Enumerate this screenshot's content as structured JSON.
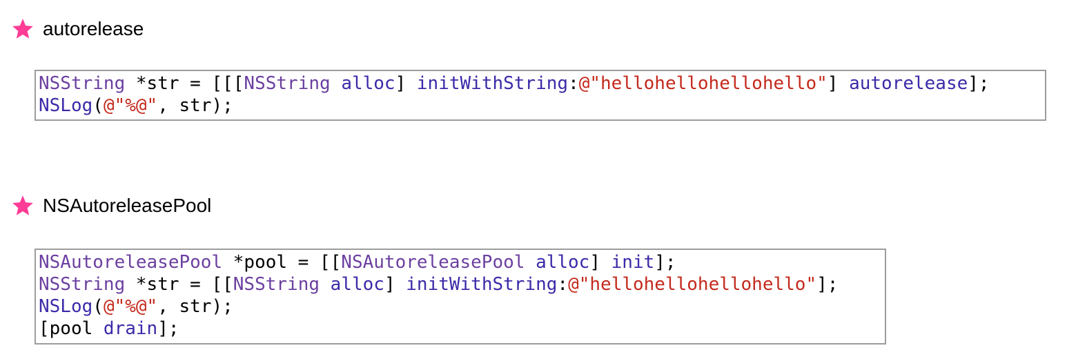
{
  "colors": {
    "star": "#ff3c96",
    "class_name": "#6b3fa0",
    "method_name": "#3a2aa8",
    "string_literal": "#c4291c",
    "plain": "#000000",
    "box_border": "#9c9c9c"
  },
  "sections": [
    {
      "icon": "star-icon",
      "heading": "autorelease",
      "code_lines": [
        [
          {
            "t": "NSString",
            "k": "class"
          },
          {
            "t": " *str = [[[",
            "k": "plain"
          },
          {
            "t": "NSString",
            "k": "class"
          },
          {
            "t": " ",
            "k": "plain"
          },
          {
            "t": "alloc",
            "k": "method"
          },
          {
            "t": "] ",
            "k": "plain"
          },
          {
            "t": "initWithString",
            "k": "method"
          },
          {
            "t": ":",
            "k": "plain"
          },
          {
            "t": "@\"hellohellohellohello\"",
            "k": "string"
          },
          {
            "t": "] ",
            "k": "plain"
          },
          {
            "t": "autorelease",
            "k": "method"
          },
          {
            "t": "];",
            "k": "plain"
          }
        ],
        [
          {
            "t": "NSLog",
            "k": "method"
          },
          {
            "t": "(",
            "k": "plain"
          },
          {
            "t": "@\"%@\"",
            "k": "string"
          },
          {
            "t": ", str);",
            "k": "plain"
          }
        ]
      ]
    },
    {
      "icon": "star-icon",
      "heading": "NSAutoreleasePool",
      "code_lines": [
        [
          {
            "t": "NSAutoreleasePool",
            "k": "class"
          },
          {
            "t": " *pool = [[",
            "k": "plain"
          },
          {
            "t": "NSAutoreleasePool",
            "k": "class"
          },
          {
            "t": " ",
            "k": "plain"
          },
          {
            "t": "alloc",
            "k": "method"
          },
          {
            "t": "] ",
            "k": "plain"
          },
          {
            "t": "init",
            "k": "method"
          },
          {
            "t": "];",
            "k": "plain"
          }
        ],
        [
          {
            "t": "NSString",
            "k": "class"
          },
          {
            "t": " *str = [[",
            "k": "plain"
          },
          {
            "t": "NSString",
            "k": "class"
          },
          {
            "t": " ",
            "k": "plain"
          },
          {
            "t": "alloc",
            "k": "method"
          },
          {
            "t": "] ",
            "k": "plain"
          },
          {
            "t": "initWithString",
            "k": "method"
          },
          {
            "t": ":",
            "k": "plain"
          },
          {
            "t": "@\"hellohellohellohello\"",
            "k": "string"
          },
          {
            "t": "];",
            "k": "plain"
          }
        ],
        [
          {
            "t": "NSLog",
            "k": "method"
          },
          {
            "t": "(",
            "k": "plain"
          },
          {
            "t": "@\"%@\"",
            "k": "string"
          },
          {
            "t": ", str);",
            "k": "plain"
          }
        ],
        [
          {
            "t": "[pool ",
            "k": "plain"
          },
          {
            "t": "drain",
            "k": "method"
          },
          {
            "t": "];",
            "k": "plain"
          }
        ]
      ]
    }
  ]
}
